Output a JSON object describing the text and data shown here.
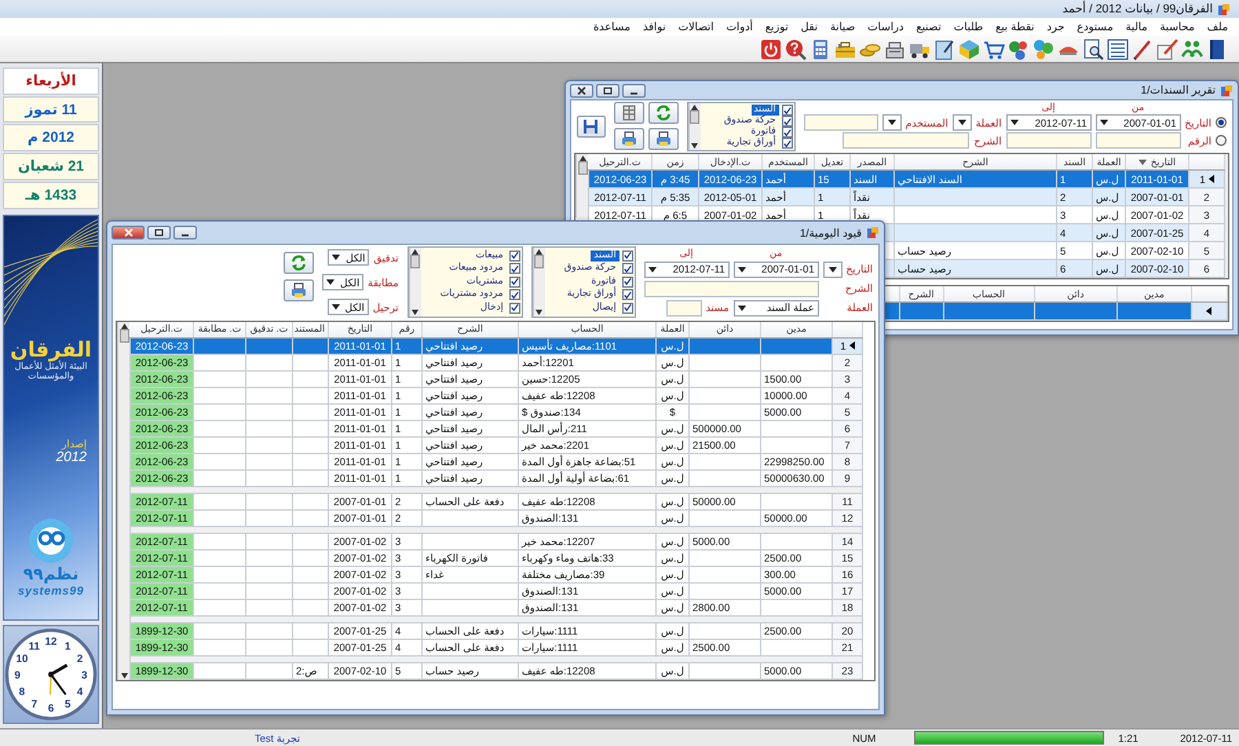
{
  "window": {
    "title": "الفرقان99 / بيانات 2012 / أحمد"
  },
  "menu": [
    "ملف",
    "محاسبة",
    "مالية",
    "مستودع",
    "جرد",
    "نقطة بيع",
    "طلبات",
    "تصنيع",
    "دراسات",
    "صيانة",
    "نقل",
    "توزيع",
    "أدوات",
    "اتصالات",
    "نوافذ",
    "مساعدة"
  ],
  "sidebar": {
    "dates": [
      {
        "text": "الأربعاء",
        "kind": "weekday"
      },
      {
        "text": "11 تموز",
        "kind": "gregorian"
      },
      {
        "text": "2012 م",
        "kind": "gregorian"
      },
      {
        "text": "21 شعبان",
        "kind": "hijri"
      },
      {
        "text": "1433 هـ",
        "kind": "hijri"
      }
    ],
    "logo": {
      "name": "الفرقان",
      "tagline": "البيئة الأمثل للأعمال والمؤسسات",
      "version_label": "إصدار",
      "version": "2012",
      "brand_ar": "نظم٩٩",
      "brand_en": "systems99"
    },
    "clock": {
      "numerals": [
        "12",
        "1",
        "11",
        "2",
        "10",
        "3",
        "9",
        "4",
        "8",
        "5",
        "7",
        "6"
      ]
    }
  },
  "report_window": {
    "title": "تقرير السندات/1",
    "filters": {
      "modes": [
        {
          "label": "التاريخ",
          "selected": true
        },
        {
          "label": "الرقم",
          "selected": false
        }
      ],
      "from_label": "من",
      "to_label": "إلى",
      "from": "2007-01-01",
      "to": "2012-07-11",
      "currency_label": "العملة",
      "user_label": "المستخدم",
      "description_label": "الشرح",
      "type_list": {
        "items": [
          {
            "label": "السند",
            "checked": true,
            "selected": true
          },
          {
            "label": "حركة صندوق",
            "checked": true,
            "selected": false
          },
          {
            "label": "فاتورة",
            "checked": true,
            "selected": false
          },
          {
            "label": "أوراق تجارية",
            "checked": true,
            "selected": false
          }
        ]
      }
    },
    "grid": {
      "columns": [
        "التاريخ",
        "العملة",
        "السند",
        "الشرح",
        "المصدر",
        "تعديل",
        "المستخدم",
        "ت.الإدخال",
        "زمن",
        "ت.الترحيل"
      ],
      "rows": [
        {
          "number": "1",
          "selected": true,
          "date": "2011-01-01",
          "currency": "ل.س",
          "voucher": "1",
          "description": "السند الافتتاحي",
          "source": "السند",
          "edits": "15",
          "user": "أحمد",
          "entry_date": "2012-06-23",
          "time": "3:45 م",
          "posting_date": "2012-06-23"
        },
        {
          "number": "2",
          "selected": false,
          "date": "2007-01-01",
          "currency": "ل.س",
          "voucher": "2",
          "source": "نقداً",
          "edits": "1",
          "user": "أحمد",
          "entry_date": "2012-05-01",
          "time": "5:35 م",
          "posting_date": "2012-07-11"
        },
        {
          "number": "3",
          "selected": false,
          "date": "2007-01-02",
          "currency": "ل.س",
          "voucher": "3",
          "source": "نقداً",
          "edits": "1",
          "user": "أحمد",
          "entry_date": "2007-01-02",
          "time": "6:5 م",
          "posting_date": "2012-07-11"
        },
        {
          "number": "4",
          "selected": false,
          "date": "2007-01-25",
          "currency": "ل.س",
          "voucher": "4"
        },
        {
          "number": "5",
          "selected": false,
          "date": "2007-02-10",
          "currency": "ل.س",
          "voucher": "5",
          "description": "رصيد حساب"
        },
        {
          "number": "6",
          "selected": false,
          "date": "2007-02-10",
          "currency": "ل.س",
          "voucher": "6",
          "description": "رصيد حساب"
        }
      ]
    },
    "detail_grid": {
      "columns": [
        "مدين",
        "دائن",
        "الحساب",
        "الشرح"
      ],
      "rows": [
        {
          "selected": true
        }
      ]
    }
  },
  "journal_window": {
    "title": "قيود اليومية/1",
    "filters": {
      "date_label": "التاريخ",
      "from_label": "من",
      "to_label": "إلى",
      "from": "2007-01-01",
      "to": "2012-07-11",
      "description_label": "الشرح",
      "currency_label": "العملة",
      "currency": "عملة السند",
      "document_label": "مسند",
      "type_list": {
        "items": [
          {
            "label": "السند",
            "checked": true,
            "selected": true
          },
          {
            "label": "حركة صندوق",
            "checked": true,
            "selected": false
          },
          {
            "label": "فاتورة",
            "checked": true,
            "selected": false
          },
          {
            "label": "أوراق تجارية",
            "checked": true,
            "selected": false
          },
          {
            "label": "إيصال",
            "checked": true,
            "selected": false
          }
        ]
      },
      "invoice_list": {
        "items": [
          {
            "label": "مبيعات",
            "checked": true
          },
          {
            "label": "مردود مبيعات",
            "checked": true
          },
          {
            "label": "مشتريات",
            "checked": true
          },
          {
            "label": "مردود مشتريات",
            "checked": true
          },
          {
            "label": "إدخال",
            "checked": true
          }
        ]
      },
      "flags": [
        {
          "label": "تدقيق",
          "value": "الكل"
        },
        {
          "label": "مطابقة",
          "value": "الكل"
        },
        {
          "label": "ترحيل",
          "value": "الكل"
        }
      ]
    },
    "grid": {
      "columns": [
        "مدين",
        "دائن",
        "العملة",
        "الحساب",
        "الشرح",
        "رقم",
        "التاريخ",
        "المستند",
        "ت. تدقيق",
        "ت. مطابقة",
        "ت.الترحيل"
      ],
      "rows": [
        {
          "kind": "entry",
          "number": "1",
          "selected": true,
          "currency": "ل.س",
          "account": "1101:مصاريف تأسيس",
          "description": "رصيد افتتاحي",
          "entry_no": "1",
          "date": "2011-01-01",
          "posting_date": "2012-06-23"
        },
        {
          "kind": "entry",
          "number": "2",
          "selected": false,
          "currency": "ل.س",
          "account": "12201:أحمد",
          "description": "رصيد افتتاحي",
          "entry_no": "1",
          "date": "2011-01-01",
          "posting_date": "2012-06-23"
        },
        {
          "kind": "entry",
          "number": "3",
          "selected": false,
          "debit": "1500.00",
          "currency": "ل.س",
          "account": "12205:حسين",
          "description": "رصيد افتتاحي",
          "entry_no": "1",
          "date": "2011-01-01",
          "posting_date": "2012-06-23"
        },
        {
          "kind": "entry",
          "number": "4",
          "selected": false,
          "debit": "10000.00",
          "currency": "ل.س",
          "account": "12208:طه عفيف",
          "description": "رصيد افتتاحي",
          "entry_no": "1",
          "date": "2011-01-01",
          "posting_date": "2012-06-23"
        },
        {
          "kind": "entry",
          "number": "5",
          "selected": false,
          "debit": "5000.00",
          "currency": "$",
          "account": "134:صندوق $",
          "description": "رصيد افتتاحي",
          "entry_no": "1",
          "date": "2011-01-01",
          "posting_date": "2012-06-23"
        },
        {
          "kind": "entry",
          "number": "6",
          "selected": false,
          "credit": "500000.00",
          "currency": "ل.س",
          "account": "211:رأس المال",
          "description": "رصيد افتتاحي",
          "entry_no": "1",
          "date": "2011-01-01",
          "posting_date": "2012-06-23"
        },
        {
          "kind": "entry",
          "number": "7",
          "selected": false,
          "credit": "21500.00",
          "currency": "ل.س",
          "account": "2201:محمد خير",
          "description": "رصيد افتتاحي",
          "entry_no": "1",
          "date": "2011-01-01",
          "posting_date": "2012-06-23"
        },
        {
          "kind": "entry",
          "number": "8",
          "selected": false,
          "debit": "22998250.00",
          "currency": "ل.س",
          "account": "51:بضاعة جاهزة أول المدة",
          "description": "رصيد افتتاحي",
          "entry_no": "1",
          "date": "2011-01-01",
          "posting_date": "2012-06-23"
        },
        {
          "kind": "entry",
          "number": "9",
          "selected": false,
          "debit": "50000630.00",
          "currency": "ل.س",
          "account": "61:بضاعة أولية أول المدة",
          "description": "رصيد افتتاحي",
          "entry_no": "1",
          "date": "2011-01-01",
          "posting_date": "2012-06-23"
        },
        {
          "kind": "separator"
        },
        {
          "kind": "entry",
          "number": "11",
          "selected": false,
          "credit": "50000.00",
          "currency": "ل.س",
          "account": "12208:طه عفيف",
          "description": "دفعة على الحساب",
          "entry_no": "2",
          "date": "2007-01-01",
          "posting_date": "2012-07-11"
        },
        {
          "kind": "entry",
          "number": "12",
          "selected": false,
          "debit": "50000.00",
          "currency": "ل.س",
          "account": "131:الصندوق",
          "entry_no": "2",
          "date": "2007-01-01",
          "posting_date": "2012-07-11"
        },
        {
          "kind": "separator"
        },
        {
          "kind": "entry",
          "number": "14",
          "selected": false,
          "credit": "5000.00",
          "currency": "ل.س",
          "account": "12207:محمد خير",
          "entry_no": "3",
          "date": "2007-01-02",
          "posting_date": "2012-07-11"
        },
        {
          "kind": "entry",
          "number": "15",
          "selected": false,
          "debit": "2500.00",
          "currency": "ل.س",
          "account": "33:هاتف وماء وكهرباء",
          "description": "فاتورة الكهرباء",
          "entry_no": "3",
          "date": "2007-01-02",
          "posting_date": "2012-07-11"
        },
        {
          "kind": "entry",
          "number": "16",
          "selected": false,
          "debit": "300.00",
          "currency": "ل.س",
          "account": "39:مصاريف مختلفة",
          "description": "غداء",
          "entry_no": "3",
          "date": "2007-01-02",
          "posting_date": "2012-07-11"
        },
        {
          "kind": "entry",
          "number": "17",
          "selected": false,
          "debit": "5000.00",
          "currency": "ل.س",
          "account": "131:الصندوق",
          "entry_no": "3",
          "date": "2007-01-02",
          "posting_date": "2012-07-11"
        },
        {
          "kind": "entry",
          "number": "18",
          "selected": false,
          "credit": "2800.00",
          "currency": "ل.س",
          "account": "131:الصندوق",
          "entry_no": "3",
          "date": "2007-01-02",
          "posting_date": "2012-07-11"
        },
        {
          "kind": "separator"
        },
        {
          "kind": "entry",
          "number": "20",
          "selected": false,
          "debit": "2500.00",
          "currency": "ل.س",
          "account": "1111:سيارات",
          "description": "دفعة على الحساب",
          "entry_no": "4",
          "date": "2007-01-25",
          "posting_date": "1899-12-30"
        },
        {
          "kind": "entry",
          "number": "21",
          "selected": false,
          "credit": "2500.00",
          "currency": "ل.س",
          "account": "1111:سيارات",
          "description": "دفعة على الحساب",
          "entry_no": "4",
          "date": "2007-01-25",
          "posting_date": "1899-12-30"
        },
        {
          "kind": "separator"
        },
        {
          "kind": "entry",
          "number": "23",
          "selected": false,
          "debit": "5000.00",
          "currency": "ل.س",
          "account": "12208:طه عفيف",
          "description": "رصيد حساب",
          "entry_no": "5",
          "date": "2007-02-10",
          "document": "ص:2",
          "posting_date": "1899-12-30"
        }
      ]
    }
  },
  "status_bar": {
    "mode": "تجربة Test",
    "keyboard": "NUM",
    "progress": {
      "level": 1
    },
    "time": "1:21",
    "date": "2012-07-11"
  }
}
